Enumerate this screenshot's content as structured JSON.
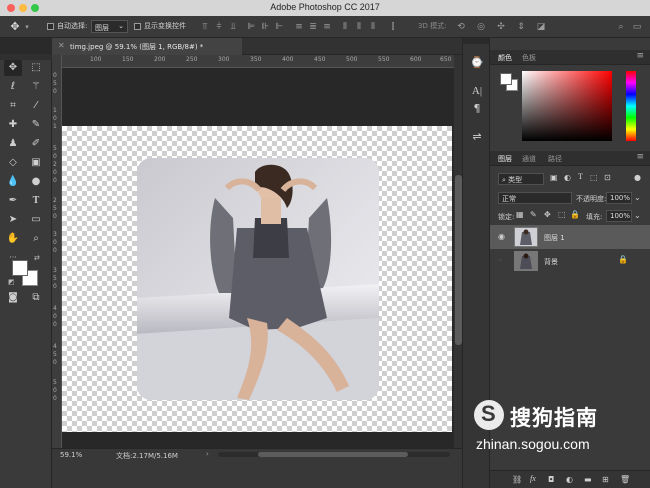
{
  "app": {
    "window_title": "Adobe Photoshop CC 2017"
  },
  "options_bar": {
    "auto_select_label": "自动选择:",
    "auto_select_target": "图层",
    "show_transform_label": "显示变换控件",
    "mode_3d_label": "3D 模式:"
  },
  "document": {
    "tab_title": "timg.jpeg @ 59.1% (图层 1, RGB/8#) *",
    "ruler_h_labels": [
      "100",
      "150",
      "200",
      "250",
      "300",
      "350",
      "400",
      "450",
      "500",
      "550",
      "600",
      "650"
    ],
    "ruler_v_labels": [
      "0",
      "5",
      "0",
      "1",
      "0",
      "1",
      "5",
      "0",
      "2",
      "0",
      "0",
      "2",
      "5",
      "0",
      "3",
      "0",
      "0",
      "3",
      "5",
      "0",
      "4",
      "0",
      "0",
      "4",
      "5",
      "0",
      "5",
      "0",
      "0"
    ]
  },
  "status": {
    "zoom": "59.1%",
    "doc_info": "文档:2.17M/5.16M"
  },
  "color_panel": {
    "tabs": [
      "颜色",
      "色板"
    ],
    "foreground": "#ffffff",
    "background": "#ffffff"
  },
  "layers_panel": {
    "tabs": [
      "图层",
      "通道",
      "路径"
    ],
    "filter_kind": "类型",
    "blend_mode": "正常",
    "opacity_label": "不透明度:",
    "opacity_value": "100%",
    "lock_label": "锁定:",
    "fill_label": "填充:",
    "fill_value": "100%",
    "layers": [
      {
        "name": "图层 1",
        "selected": true
      },
      {
        "name": "背景",
        "locked": true
      }
    ]
  },
  "watermark": {
    "brand": "搜狗指南",
    "url": "zhinan.sogou.com"
  }
}
